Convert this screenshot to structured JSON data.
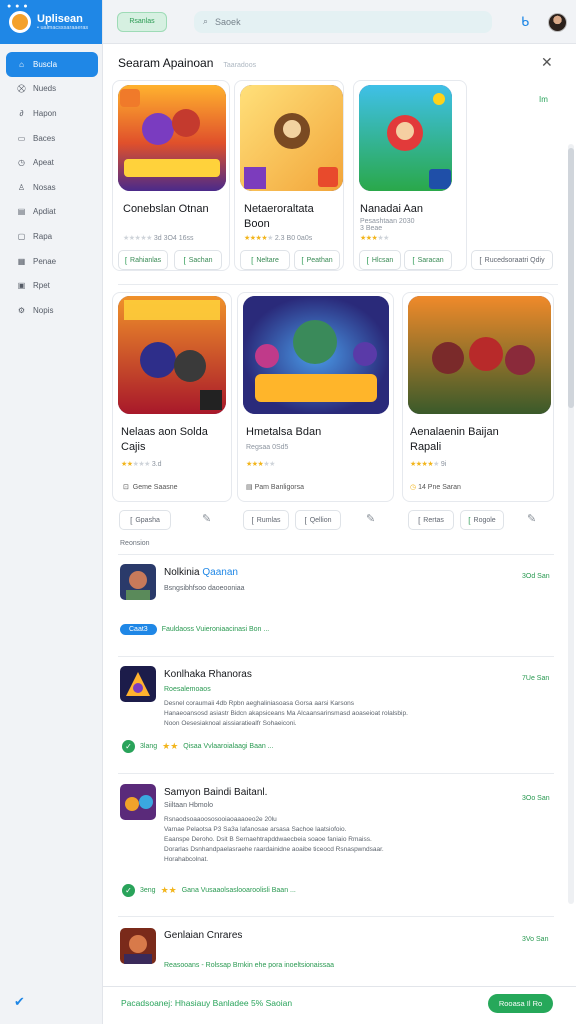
{
  "sidebar": {
    "brand": {
      "title": "Uplisean",
      "subtitle": "• ualmacsssaraaeras"
    },
    "items": [
      {
        "label": "Buscla",
        "icon": "home-icon",
        "active": true
      },
      {
        "label": "Nueds",
        "icon": "cart-icon"
      },
      {
        "label": "Hapon",
        "icon": "link-icon"
      },
      {
        "label": "Baces",
        "icon": "chat-icon"
      },
      {
        "label": "Apeat",
        "icon": "clock-icon"
      },
      {
        "label": "Nosas",
        "icon": "user-icon"
      },
      {
        "label": "Apdiat",
        "icon": "document-icon"
      },
      {
        "label": "Rapa",
        "icon": "folder-icon"
      },
      {
        "label": "Penae",
        "icon": "calendar-icon"
      },
      {
        "label": "Rpet",
        "icon": "monitor-icon"
      },
      {
        "label": "Nopis",
        "icon": "gear-icon"
      }
    ]
  },
  "topbar": {
    "chip": "Rsanlas",
    "search_placeholder": "Saoek"
  },
  "panel": {
    "title": "Searam Apainoan",
    "subtitle": "Taaradoos",
    "link": "Im",
    "row1": [
      {
        "title": "Conebslan Otnan",
        "rating": "★★★★★",
        "meta": "3d 3O4 16ss",
        "rating_count": 0,
        "btn1": "Rahianlas",
        "btn2": "Sachan"
      },
      {
        "title": "Netaeroraltata\nBoon",
        "rating": "★★★★★",
        "meta": "2.3 B0 0a0s",
        "rating_count": 4,
        "btn1": "Neltare",
        "btn2": "Peathan"
      },
      {
        "title": "Nanadai Aan",
        "rating": "★★★★★",
        "meta": "Pesashtaan 2030\n3 Beae",
        "rating_count": 3,
        "btn1": "Hlcsan",
        "btn2": "Saracan",
        "btn3": "Rucedsoraatri Qdiy"
      }
    ],
    "row2": [
      {
        "title": "Nelaas aon Solda\nCajis",
        "rating": "★★★★★",
        "meta": "3.d",
        "rating_count": 2,
        "foot": "Geme Saasne",
        "foot_icon": "controller-icon"
      },
      {
        "title": "Hmetalsa Bdan",
        "rating": "★★★★★",
        "meta": "Regsaa 0Sd5",
        "rating_count": 3,
        "foot": "Pam Banligorsa",
        "foot_icon": "document-icon"
      },
      {
        "title": "Aenalaenin Baijan\nRapali",
        "rating": "★★★★★",
        "meta": "9i",
        "rating_count": 4,
        "foot": "14 Pne Saran",
        "foot_icon": "clock-icon"
      }
    ],
    "row_actions": [
      {
        "a": "Gpasha",
        "b": ""
      },
      {
        "a": "Rumlas",
        "b": "Qellion"
      },
      {
        "a": "Rertas",
        "b": "Rogole"
      }
    ],
    "section_label": "Reonsion",
    "list": [
      {
        "title": "Nolkinia",
        "title_hl": "Qaanan",
        "sub": "Bsngsibhfsoo daoeooniaa",
        "right": "3Od San",
        "desc": "",
        "pill": "Caat3",
        "foot": "Fauldaoss   Vuieroniaacinasi Bon ..."
      },
      {
        "title": "Konlhaka Rhanoras",
        "title_hl": "",
        "sub": "Roesalemoaos",
        "right": "7Ue San",
        "desc": "Desnel coraumaii 4db Rpbn aeghaliniasoasa Gorsa aarsi Karsons\nHanaeoansosd asiastr Bidcn akapsiceans Ma Alcaansarinsmasd aoaseioat rolalsbip.\nNoon Oesesiaknoal aissiaratiealfr Sohaeiconi.",
        "check": "3lang",
        "foot": "Qisaa   Vvlaaroialaagi Baan ..."
      },
      {
        "title": "Samyon Baindi Baitanl.",
        "title_hl": "",
        "sub": "Siiltaan Hbmolo",
        "right": "3Oo San",
        "desc": "Rsnaodsoaaoososooiaoaaaoeo2e 20lu\nVarnae Pelaotsa P3 Sa3a lafanosae arsasa Sachoe laatsiofoio.\nEaanspe Deroho. Dsit B Sernaehtrapddwaecbeia soaoe faniaio Rmaiss.\nDorarlas Dsnhandpaelasraehe raardainidne aoaibe ticeocd Rsnaspwndsaar.\nHorahabcolnat.",
        "check": "3eng",
        "foot": "Gana   Vusaaolsaslooaroolisli Baan ..."
      },
      {
        "title": "Genlaian Cnrares",
        "title_hl": "",
        "sub": "Reasooans - Rolssap Brnkin ehe pora inoeltsionaissaa",
        "right": "3Vo San",
        "desc": ""
      }
    ],
    "footer": {
      "text": "Pacadsoanej: Hhasiauy Banladee 5% Saoian",
      "button": "Rooasa  Il Ro"
    }
  },
  "colors": {
    "accent": "#1f87e6",
    "green": "#29a35a",
    "star": "#f2b51c"
  }
}
